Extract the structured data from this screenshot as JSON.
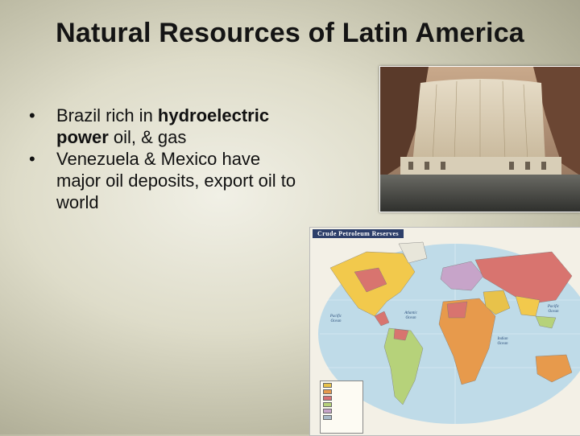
{
  "slide": {
    "title": "Natural Resources of Latin America",
    "bullets": [
      {
        "pre": "Brazil rich in ",
        "bold": "hydroelectric power",
        "post": " oil, & gas"
      },
      {
        "pre": "Venezuela & Mexico have major oil deposits, export oil to world",
        "bold": "",
        "post": ""
      }
    ]
  },
  "map": {
    "header": "Crude Petroleum Reserves",
    "oceans": {
      "pacific_left": "Pacific Ocean",
      "atlantic": "Atlantic Ocean",
      "indian": "Indian Ocean",
      "pacific_right": "Pacific Ocean"
    },
    "legend_colors": [
      "#e8c24a",
      "#e79a4c",
      "#d86f73",
      "#b6d27a",
      "#c7a4c9",
      "#a8b9c8"
    ]
  },
  "colors": {
    "map_header_bg": "#2d3f6a",
    "water": "#bfdbe8"
  }
}
